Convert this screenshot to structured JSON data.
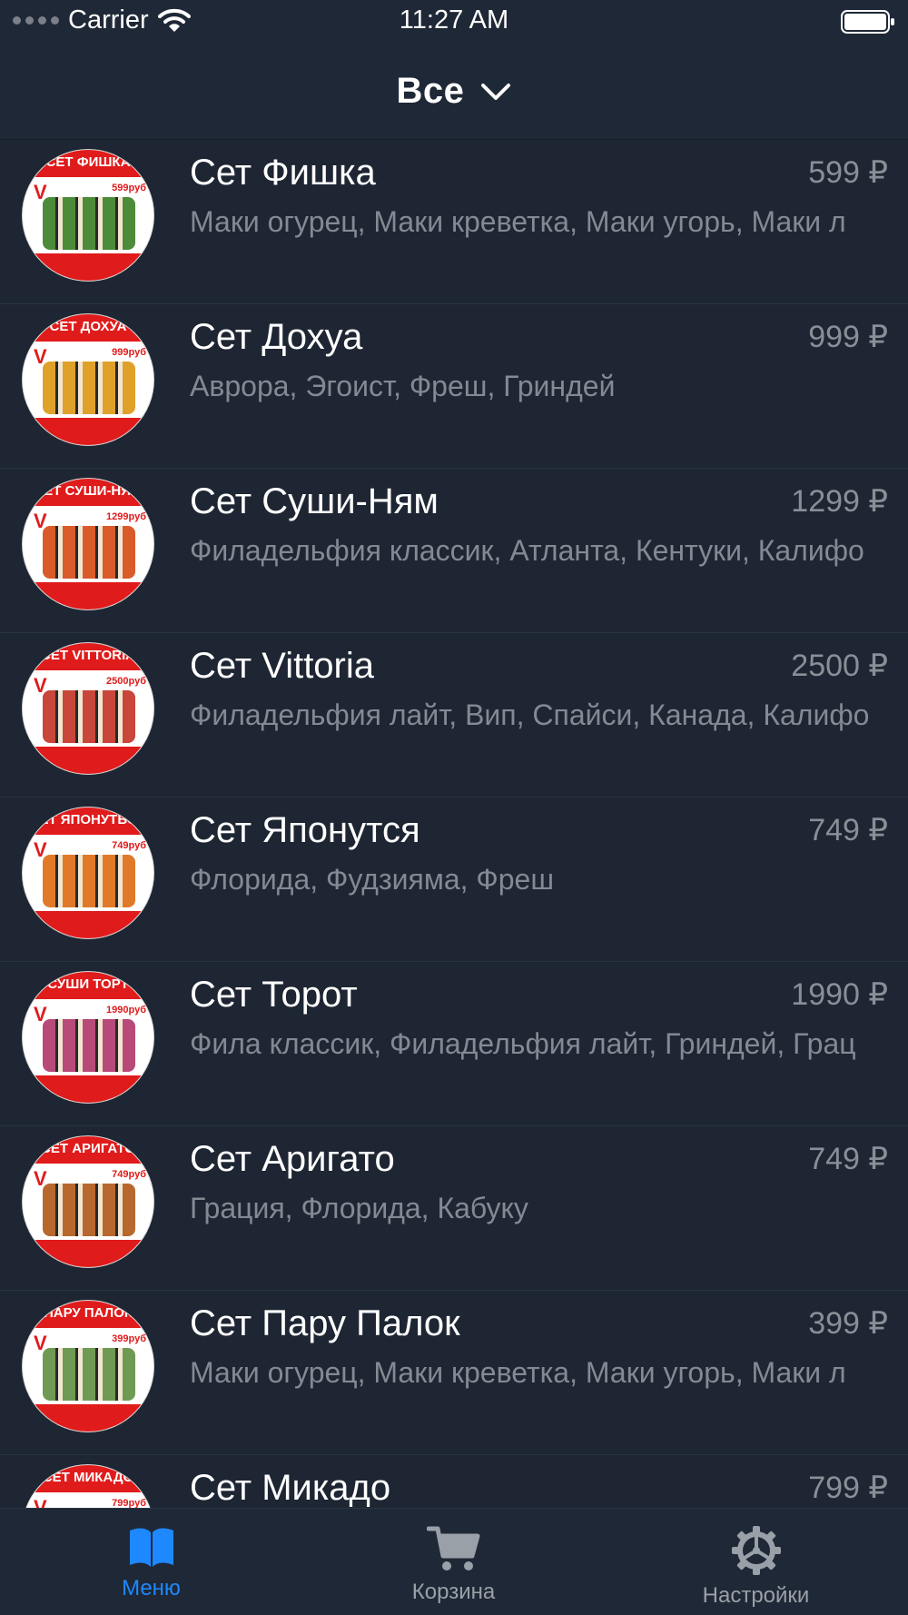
{
  "status_bar": {
    "carrier": "Carrier",
    "time": "11:27 AM"
  },
  "nav": {
    "title": "Все"
  },
  "items": [
    {
      "name": "Сет Фишка",
      "price": "599 ₽",
      "desc": "Маки огурец, Маки креветка, Маки угорь, Маки л",
      "thumb_title": "СЕТ ФИШКА",
      "thumb_price": "599руб",
      "food_color": "#4c8b3a"
    },
    {
      "name": "Сет Дохуа",
      "price": "999 ₽",
      "desc": "Аврора, Эгоист, Фреш, Гриндей",
      "thumb_title": "СЕТ ДОХУА",
      "thumb_price": "999руб",
      "food_color": "#e0a12a"
    },
    {
      "name": "Сет Суши-Ням",
      "price": "1299 ₽",
      "desc": "Филадельфия классик, Атланта, Кентуки, Калифо",
      "thumb_title": "СЕТ СУШИ-НЯМ",
      "thumb_price": "1299руб",
      "food_color": "#d95b2a"
    },
    {
      "name": "Сет Vittoria",
      "price": "2500 ₽",
      "desc": "Филадельфия лайт, Вип, Спайси, Канада, Калифо",
      "thumb_title": "СЕТ VITTORIA",
      "thumb_price": "2500руб",
      "food_color": "#c9463a"
    },
    {
      "name": "Сет Японутся",
      "price": "749 ₽",
      "desc": "Флорида, Фудзияма, Фреш",
      "thumb_title": "СЕТ ЯПОНУТЬСЯ",
      "thumb_price": "749руб",
      "food_color": "#e07a28"
    },
    {
      "name": "Сет Торот",
      "price": "1990 ₽",
      "desc": "Фила классик, Филадельфия лайт, Гриндей, Грац",
      "thumb_title": "СУШИ ТОРТ",
      "thumb_price": "1990руб",
      "food_color": "#b84a7a"
    },
    {
      "name": "Сет Аригато",
      "price": "749 ₽",
      "desc": "Грация, Флорида, Кабуку",
      "thumb_title": "СЕТ АРИГАТО",
      "thumb_price": "749руб",
      "food_color": "#b8682e"
    },
    {
      "name": "Сет Пару Палок",
      "price": "399 ₽",
      "desc": "Маки огурец, Маки креветка, Маки угорь, Маки л",
      "thumb_title": "ПАРУ ПАЛОК",
      "thumb_price": "399руб",
      "food_color": "#6e9a54"
    },
    {
      "name": "Сет Микадо",
      "price": "799 ₽",
      "desc": "",
      "thumb_title": "СЕТ МИКАДО",
      "thumb_price": "799руб",
      "food_color": "#d0603a"
    }
  ],
  "tabs": [
    {
      "label": "Меню",
      "icon": "book-icon"
    },
    {
      "label": "Корзина",
      "icon": "cart-icon"
    },
    {
      "label": "Настройки",
      "icon": "gear-icon"
    }
  ],
  "colors": {
    "background": "#1e2633",
    "bars": "#1f2836",
    "accent": "#1e88ff",
    "thumb_red": "#e01b1b"
  }
}
